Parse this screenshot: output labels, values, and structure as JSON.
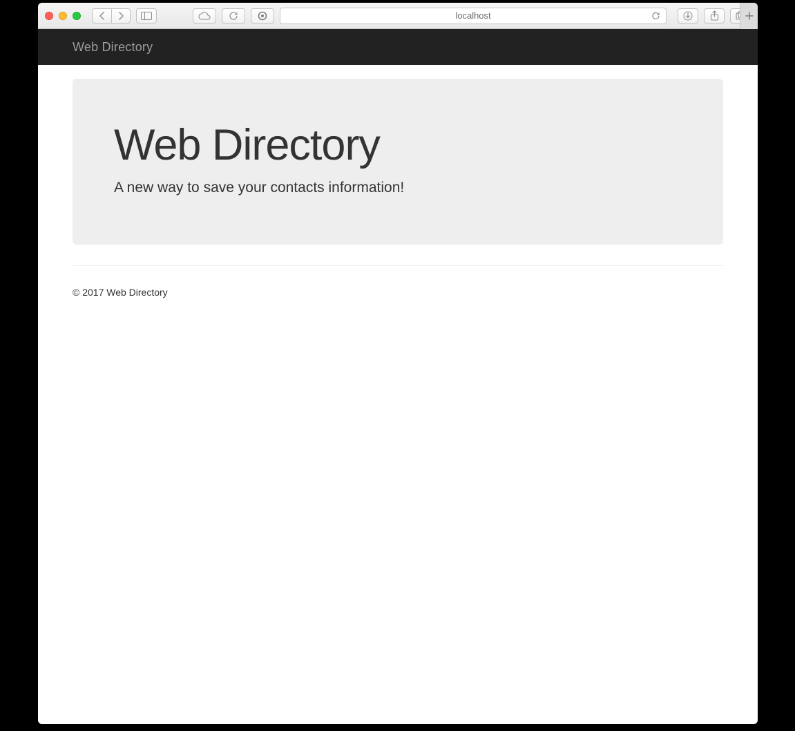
{
  "browser": {
    "address": "localhost",
    "icons": {
      "back": "chevron-left-icon",
      "forward": "chevron-right-icon",
      "sidebar": "sidebar-icon",
      "cloud": "cloud-icon",
      "sync": "sync-icon",
      "reader": "reader-icon",
      "reload": "reload-icon",
      "downloads": "download-icon",
      "share": "share-icon",
      "tabs": "tabs-icon",
      "newtab": "plus-icon"
    }
  },
  "navbar": {
    "brand": "Web Directory"
  },
  "hero": {
    "title": "Web Directory",
    "subtitle": "A new way to save your contacts information!"
  },
  "footer": {
    "copyright": "© 2017 Web Directory"
  }
}
